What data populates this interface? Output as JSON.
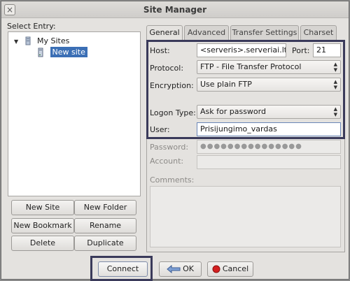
{
  "window": {
    "title": "Site Manager"
  },
  "left": {
    "select_entry_label": "Select Entry:",
    "tree": [
      {
        "label": "My Sites",
        "expanded": true
      },
      {
        "label": "New site",
        "selected": true
      }
    ],
    "buttons": {
      "new_site": "New Site",
      "new_folder": "New Folder",
      "new_bookmark": "New Bookmark",
      "rename": "Rename",
      "delete": "Delete",
      "duplicate": "Duplicate"
    }
  },
  "tabs": [
    {
      "label": "General",
      "active": true
    },
    {
      "label": "Advanced"
    },
    {
      "label": "Transfer Settings"
    },
    {
      "label": "Charset"
    }
  ],
  "general": {
    "host_label": "Host:",
    "host_value": "<serveris>.serveriai.lt",
    "port_label": "Port:",
    "port_value": "21",
    "protocol_label": "Protocol:",
    "protocol_value": "FTP - File Transfer Protocol",
    "encryption_label": "Encryption:",
    "encryption_value": "Use plain FTP",
    "logon_label": "Logon Type:",
    "logon_value": "Ask for password",
    "user_label": "User:",
    "user_value": "Prisijungimo_vardas",
    "password_label": "Password:",
    "password_value": "●●●●●●●●●●●●●●●",
    "account_label": "Account:",
    "account_value": "",
    "comments_label": "Comments:"
  },
  "bottom": {
    "connect": "Connect",
    "ok": "OK",
    "cancel": "Cancel"
  },
  "colors": {
    "highlight_border": "#3a3a5a",
    "selection": "#3b6fb5",
    "cancel_icon": "#d42020"
  }
}
